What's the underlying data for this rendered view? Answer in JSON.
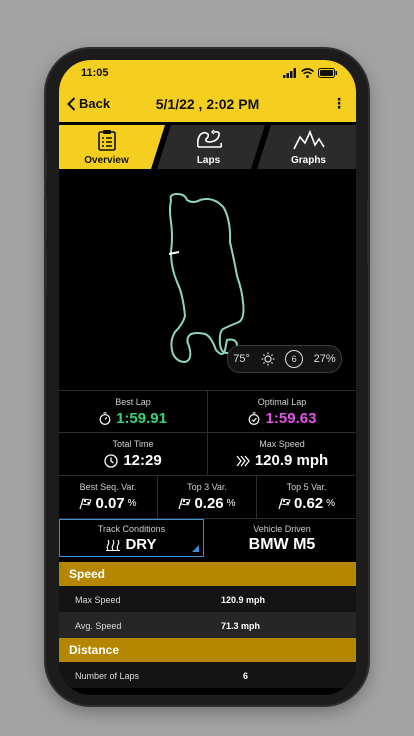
{
  "status": {
    "time": "11:05"
  },
  "nav": {
    "back_label": "Back",
    "title": "5/1/22 , 2:02 PM",
    "more_label": "⋮"
  },
  "tabs": [
    {
      "label": "Overview",
      "active": true,
      "icon": "clipboard-icon"
    },
    {
      "label": "Laps",
      "active": false,
      "icon": "lap-loop-icon"
    },
    {
      "label": "Graphs",
      "active": false,
      "icon": "line-graph-icon"
    }
  ],
  "weather": {
    "temp": "75°",
    "condition_icon": "sun-icon",
    "gear": "6",
    "humidity": "27%"
  },
  "stats": {
    "best_lap": {
      "label": "Best Lap",
      "value": "1:59.91",
      "color": "#35d27a"
    },
    "optimal_lap": {
      "label": "Optimal Lap",
      "value": "1:59.63",
      "color": "#e552e8"
    },
    "total_time": {
      "label": "Total Time",
      "value": "12:29"
    },
    "max_speed": {
      "label": "Max Speed",
      "value": "120.9 mph"
    },
    "best_seq_var": {
      "label": "Best Seq. Var.",
      "value": "0.07",
      "unit": "%"
    },
    "top3_var": {
      "label": "Top 3 Var.",
      "value": "0.26",
      "unit": "%"
    },
    "top5_var": {
      "label": "Top 5 Var.",
      "value": "0.62",
      "unit": "%"
    }
  },
  "conditions": {
    "label": "Track Conditions",
    "value": "DRY"
  },
  "vehicle": {
    "label": "Vehicle Driven",
    "value": "BMW M5"
  },
  "speed_section": {
    "title": "Speed",
    "rows": [
      {
        "label": "Max Speed",
        "value": "120.9 mph"
      },
      {
        "label": "Avg. Speed",
        "value": "71.3 mph"
      }
    ]
  },
  "distance_section": {
    "title": "Distance",
    "rows": [
      {
        "label": "Number of Laps",
        "value": "6"
      }
    ]
  },
  "colors": {
    "accent": "#f5cf1f",
    "section": "#b58600",
    "track": "#8fd6c0",
    "selected_border": "#3f8fd6"
  }
}
